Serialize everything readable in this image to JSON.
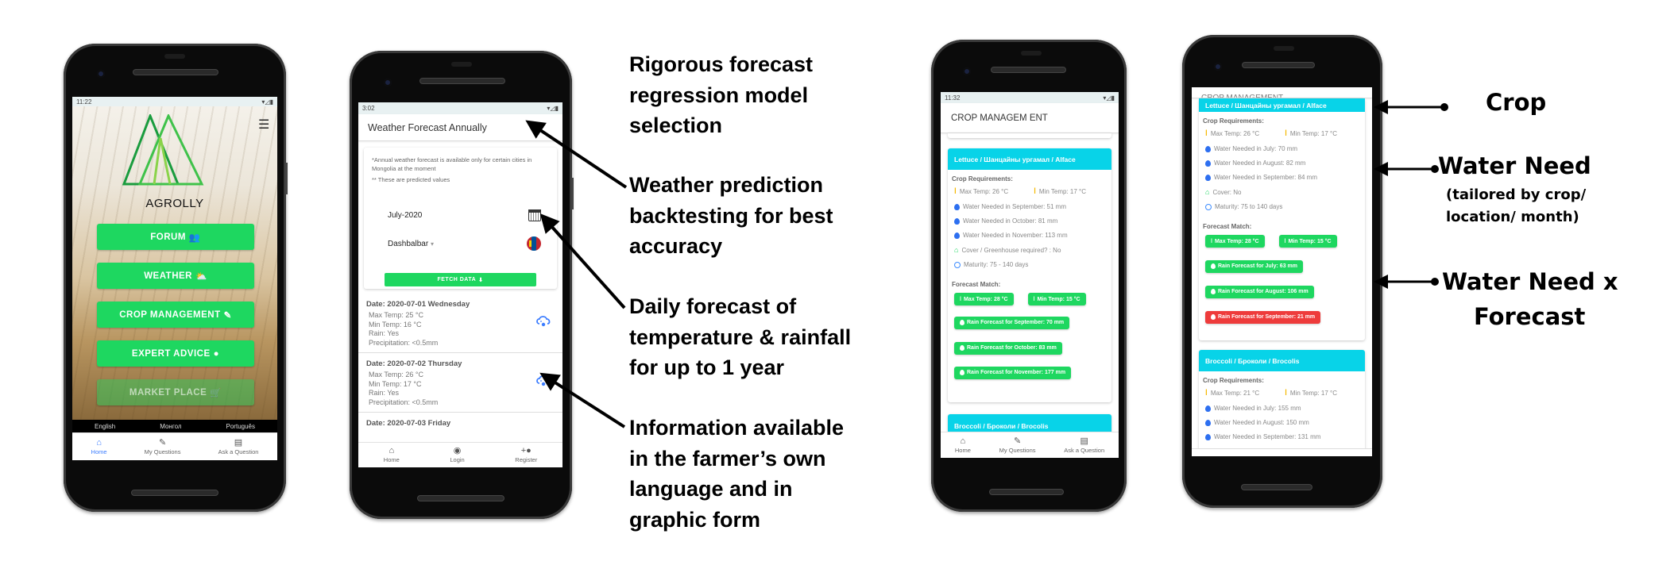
{
  "phone_home": {
    "status_time": "11:22",
    "app_name": "AGROLLY",
    "menu_buttons": [
      {
        "label": "FORUM",
        "icon": "group-icon"
      },
      {
        "label": "WEATHER",
        "icon": "partly-cloudy-icon"
      },
      {
        "label": "CROP MANAGEMENT",
        "icon": "carrot-icon"
      },
      {
        "label": "EXPERT ADVICE",
        "icon": "lightbulb-icon"
      },
      {
        "label": "MARKET PLACE",
        "icon": "cart-icon"
      }
    ],
    "languages": [
      "English",
      "Монгол",
      "Português"
    ],
    "bottom_nav": [
      {
        "label": "Home",
        "icon": "home-icon",
        "active": true
      },
      {
        "label": "My Questions",
        "icon": "pencil-icon",
        "active": false
      },
      {
        "label": "Ask a Question",
        "icon": "chat-icon",
        "active": false
      }
    ]
  },
  "phone_weather": {
    "status_time": "3:02",
    "title": "Weather Forecast Annually",
    "note_1": "*Annual weather forecast is available only for certain cities in Mongolia at the moment",
    "note_2": "** These are predicted values",
    "month_value": "July-2020",
    "city_value": "Dashbalbar",
    "city_caret": "▾",
    "fetch_label": "FETCH DATA",
    "days": [
      {
        "date": "Date: 2020-07-01 Wednesday",
        "max": "Max Temp: 25 °C",
        "min": "Min Temp: 16 °C",
        "rain": "Rain: Yes",
        "precip": "Precipitation: <0.5mm"
      },
      {
        "date": "Date: 2020-07-02 Thursday",
        "max": "Max Temp: 26 °C",
        "min": "Min Temp: 17 °C",
        "rain": "Rain: Yes",
        "precip": "Precipitation: <0.5mm"
      },
      {
        "date": "Date: 2020-07-03 Friday"
      }
    ],
    "bottom_nav": [
      {
        "label": "Home",
        "icon": "home-icon"
      },
      {
        "label": "Login",
        "icon": "account-circle-icon"
      },
      {
        "label": "Register",
        "icon": "person-add-icon"
      }
    ]
  },
  "phone_crop": {
    "status_time": "11:32",
    "title": "CROP MANAGEM ENT",
    "card": {
      "header": "Lettuce / Шанцайны ургамал / Alface",
      "requirements_label": "Crop Requirements:",
      "max_temp": "Max Temp: 26 °C",
      "min_temp": "Min Temp: 17 °C",
      "water": [
        "Water Needed in September: 51 mm",
        "Water Needed in October: 81 mm",
        "Water Needed in November: 113 mm"
      ],
      "cover": "Cover / Greenhouse required? : No",
      "maturity": "Maturity: 75 - 140 days",
      "forecast_label": "Forecast Match:",
      "forecast_max": "Max Temp: 28 °C",
      "forecast_min": "Min Temp: 15 °C",
      "rain": [
        {
          "label": "Rain Forecast for September: 70 mm",
          "status": "ok"
        },
        {
          "label": "Rain Forecast for October: 83 mm",
          "status": "ok"
        },
        {
          "label": "Rain Forecast for November: 177 mm",
          "status": "ok"
        }
      ]
    },
    "next_card_header": "Broccoli / Броколи / Brocolis",
    "bottom_nav": [
      {
        "label": "Home",
        "icon": "home-icon"
      },
      {
        "label": "My Questions",
        "icon": "pencil-icon"
      },
      {
        "label": "Ask a Question",
        "icon": "chat-icon"
      }
    ]
  },
  "phone_crop2": {
    "title_partial": "CROP MANAGEMENT",
    "card": {
      "header": "Lettuce / Шанцайны ургамал / Alface",
      "requirements_label": "Crop Requirements:",
      "max_temp": "Max Temp: 26 °C",
      "min_temp": "Min Temp: 17 °C",
      "water": [
        "Water Needed in July: 70 mm",
        "Water Needed in August: 82 mm",
        "Water Needed in September: 84 mm"
      ],
      "cover": "Cover: No",
      "maturity": "Maturity: 75 to 140 days",
      "forecast_label": "Forecast Match:",
      "forecast_max": "Max Temp: 28 °C",
      "forecast_min": "Min Temp: 15 °C",
      "rain": [
        {
          "label": "Rain Forecast for July: 63 mm",
          "status": "ok"
        },
        {
          "label": "Rain Forecast for August: 106 mm",
          "status": "ok"
        },
        {
          "label": "Rain Forecast for September: 21 mm",
          "status": "deficit"
        }
      ]
    },
    "card2": {
      "header": "Broccoli / Броколи / Brocolis",
      "requirements_label": "Crop Requirements:",
      "max_temp": "Max Temp: 21 °C",
      "min_temp": "Min Temp: 17 °C",
      "water": [
        "Water Needed in July: 155 mm",
        "Water Needed in August: 150 mm",
        "Water Needed in September: 131 mm"
      ]
    }
  },
  "annotations_left": [
    [
      "Rigorous forecast",
      "regression model",
      "selection"
    ],
    [
      "Weather prediction",
      "backtesting for best",
      "accuracy"
    ],
    [
      "Daily forecast of",
      "temperature & rainfall",
      "for up to 1 year"
    ],
    [
      "Information available",
      "in the farmer’s own",
      "language and in",
      "graphic form"
    ]
  ],
  "annotations_right": {
    "crop": "Crop",
    "water_need": "Water Need",
    "water_need_sub_1": "(tailored by crop/",
    "water_need_sub_2": "location/ month)",
    "water_forecast_1": "Water Need x",
    "water_forecast_2": "Forecast"
  },
  "colors": {
    "primary_green": "#1ed760",
    "crop_header_cyan": "#08d3e8",
    "deficit_red": "#ee3b3b",
    "active_blue": "#3c7dff"
  }
}
